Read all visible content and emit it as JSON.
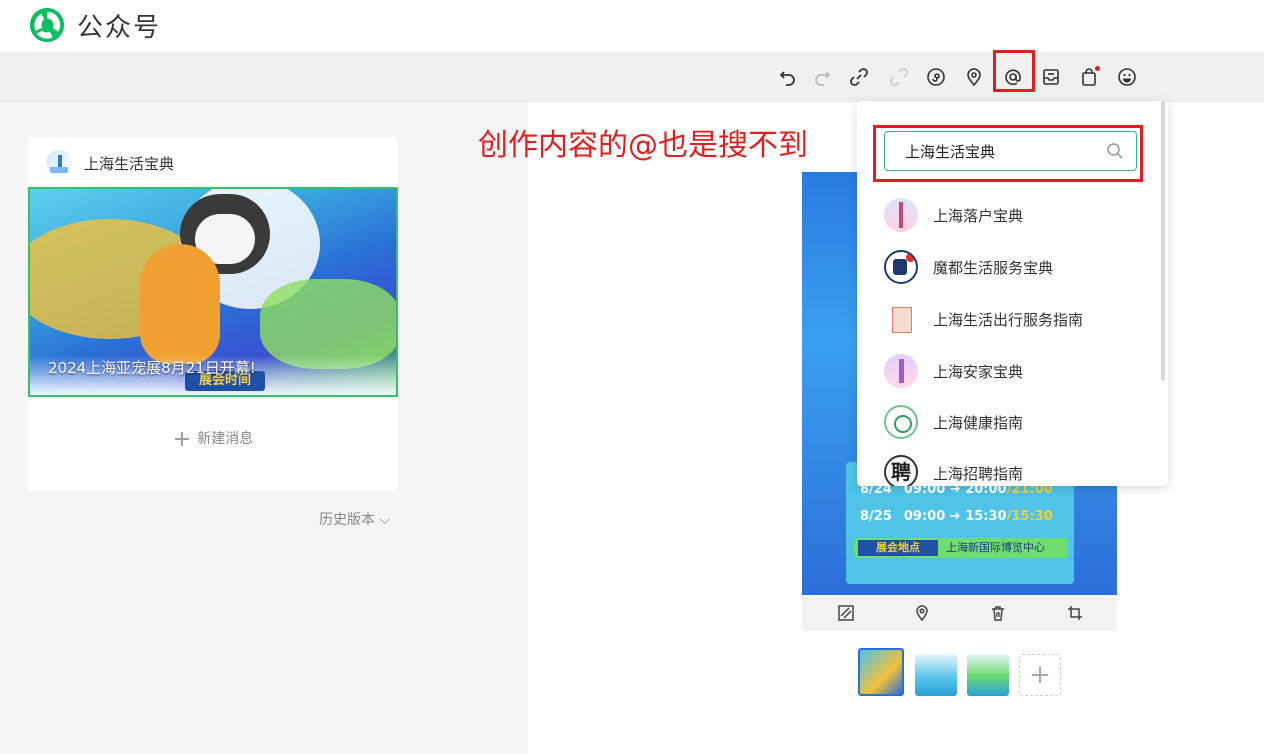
{
  "app": {
    "brand": "公众号",
    "brand_color": "#07c160"
  },
  "toolbar": {
    "icons": [
      "undo-icon",
      "redo-icon",
      "link-icon",
      "unlink-icon",
      "mini-program-icon",
      "location-icon",
      "mention-icon",
      "product-card-icon",
      "shop-bag-icon",
      "emoji-icon"
    ]
  },
  "article_card": {
    "account_name": "上海生活宝典",
    "cover_title": "2024上海亚宠展8月21日开幕!",
    "cover_badge": "展会时间",
    "new_message_plus": "+",
    "new_message_label": "新建消息",
    "history_label": "历史版本 ⌵"
  },
  "annotation": {
    "text": "创作内容的@也是搜不到",
    "color": "#e02020"
  },
  "poster": {
    "schedule": [
      {
        "date": "8/24",
        "time": "09:00 ➔ 20:00",
        "end": "/21:00"
      },
      {
        "date": "8/25",
        "time": "09:00 ➔ 15:30",
        "end": "/15:30"
      }
    ],
    "venue_tag": "展会地点",
    "venue_name": "上海新国际博览中心"
  },
  "image_tools": [
    "replace-image-icon",
    "location-icon",
    "delete-icon",
    "crop-icon"
  ],
  "thumbnails": {
    "add_label": "+"
  },
  "mention_dropdown": {
    "search_value": "上海生活宝典",
    "results": [
      {
        "name": "上海落户宝典"
      },
      {
        "name": "魔都生活服务宝典"
      },
      {
        "name": "上海生活出行服务指南"
      },
      {
        "name": "上海安家宝典"
      },
      {
        "name": "上海健康指南"
      },
      {
        "name": "上海招聘指南",
        "avatar_glyph": "聘"
      }
    ]
  }
}
